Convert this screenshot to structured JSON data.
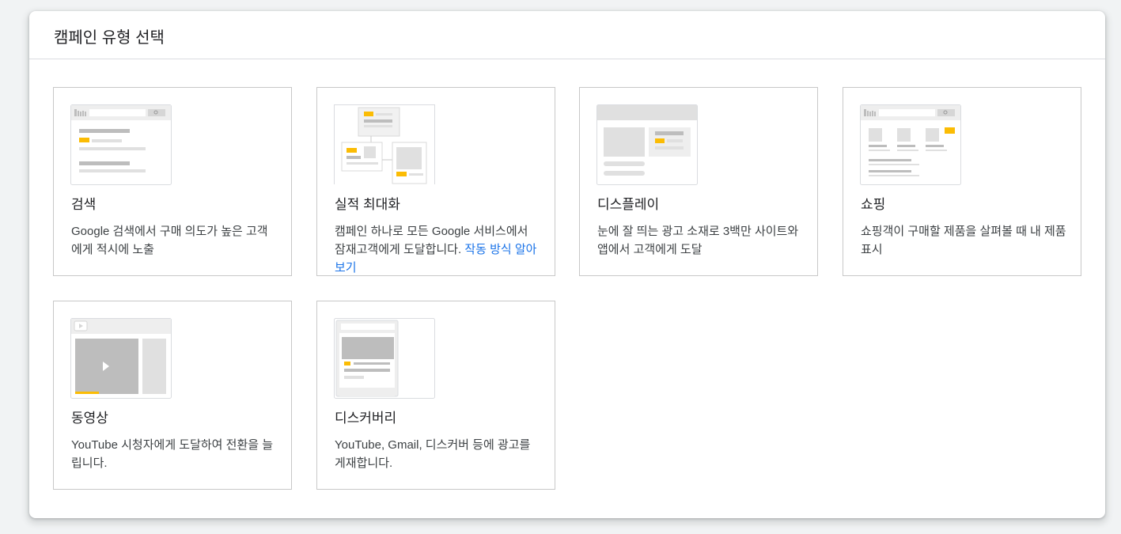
{
  "dialog": {
    "title": "캠페인 유형 선택"
  },
  "cards": [
    {
      "title": "검색",
      "description": "Google 검색에서 구매 의도가 높은 고객에게 적시에 노출"
    },
    {
      "title": "실적 최대화",
      "description": "캠페인 하나로 모든 Google 서비스에서 잠재고객에게 도달합니다.",
      "link": "작동 방식 알아보기"
    },
    {
      "title": "디스플레이",
      "description": "눈에 잘 띄는 광고 소재로 3백만 사이트와 앱에서 고객에게 도달"
    },
    {
      "title": "쇼핑",
      "description": "쇼핑객이 구매할 제품을 살펴볼 때 내 제품 표시"
    },
    {
      "title": "동영상",
      "description": "YouTube 시청자에게 도달하여 전환을 늘립니다."
    },
    {
      "title": "디스커버리",
      "description": "YouTube, Gmail, 디스커버 등에 광고를 게재합니다."
    }
  ],
  "colors": {
    "accent": "#fbbc04",
    "link": "#1a73e8",
    "border": "#c8c8c8",
    "placeholder": "#e0e0e0"
  }
}
